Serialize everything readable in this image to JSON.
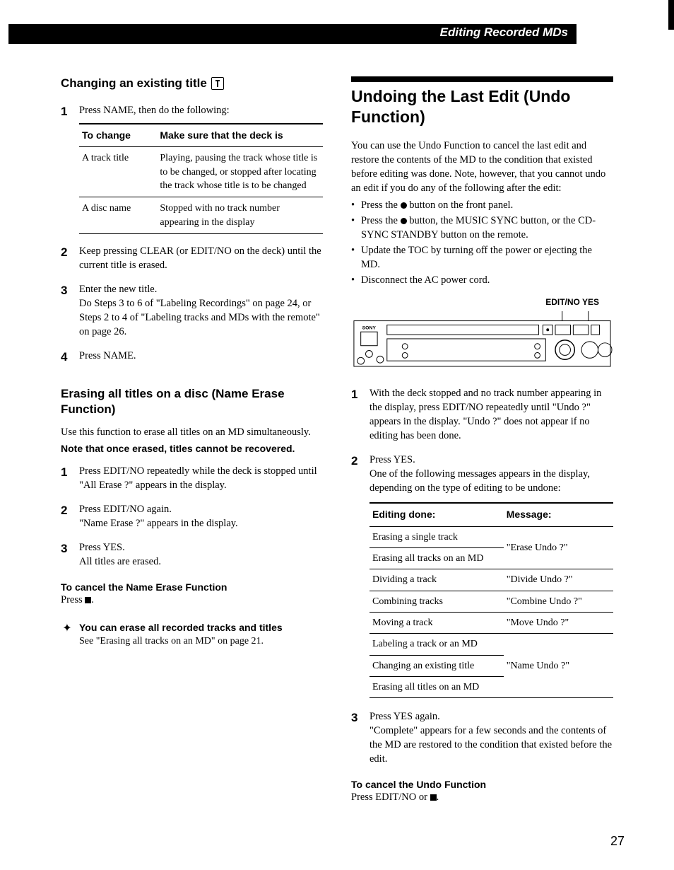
{
  "header": {
    "section": "Editing Recorded MDs"
  },
  "left": {
    "changing": {
      "title": "Changing an existing title",
      "step1": "Press NAME, then do the following:",
      "table": {
        "h1": "To change",
        "h2": "Make sure that the deck is",
        "r1c1": "A track title",
        "r1c2": "Playing, pausing the track whose title is to be changed, or stopped after locating the track whose title is to be changed",
        "r2c1": "A disc name",
        "r2c2": "Stopped with no track number appearing in the display"
      },
      "step2": "Keep pressing CLEAR (or EDIT/NO on the deck) until the current title is erased.",
      "step3a": "Enter the new title.",
      "step3b": "Do Steps 3 to 6 of \"Labeling Recordings\" on page 24, or Steps 2 to 4 of \"Labeling tracks and MDs with the remote\" on page 26.",
      "step4": "Press NAME."
    },
    "erase": {
      "title": "Erasing all titles on a disc (Name Erase Function)",
      "intro": "Use this function to erase all titles on an MD simultaneously.",
      "note": "Note that once erased, titles cannot be recovered.",
      "step1": "Press EDIT/NO repeatedly while the deck is stopped until \"All Erase ?\" appears in the display.",
      "step2a": "Press EDIT/NO again.",
      "step2b": "\"Name Erase ?\" appears in the display.",
      "step3a": "Press YES.",
      "step3b": "All titles are erased.",
      "cancel_h": "To cancel the Name Erase Function",
      "cancel_b": "Press ",
      "tip_h": "You can erase all recorded tracks and titles",
      "tip_b": "See \"Erasing all tracks on an MD\" on page 21."
    }
  },
  "right": {
    "undo": {
      "title": "Undoing the Last Edit (Undo Function)",
      "intro": "You can use the Undo Function to cancel the last edit and restore the contents of the MD to the condition that existed before editing was done. Note, however, that you cannot undo an edit if you do any of the following after the edit:",
      "b1a": "Press the ",
      "b1b": " button on the front panel.",
      "b2a": "Press the ",
      "b2b": " button, the MUSIC SYNC button, or the CD-SYNC STANDBY button on the remote.",
      "b3": "Update the TOC by turning off the power or ejecting the MD.",
      "b4": "Disconnect the AC power cord.",
      "fig_label": "EDIT/NO   YES",
      "step1": "With the deck stopped and no track number appearing in the display, press EDIT/NO repeatedly until \"Undo ?\" appears in the display. \"Undo ?\" does not appear if no editing has been done.",
      "step2a": "Press YES.",
      "step2b": "One of the following messages appears in the display, depending on the type of editing to be undone:",
      "table": {
        "h1": "Editing done:",
        "h2": "Message:",
        "r1": "Erasing a single track",
        "r2": "Erasing all tracks on an MD",
        "m1": "\"Erase Undo ?\"",
        "r3": "Dividing a track",
        "m3": "\"Divide Undo ?\"",
        "r4": "Combining tracks",
        "m4": "\"Combine Undo ?\"",
        "r5": "Moving a track",
        "m5": "\"Move Undo ?\"",
        "r6": "Labeling a track or an MD",
        "r7": "Changing an existing title",
        "r8": "Erasing all titles on an MD",
        "m6": "\"Name Undo ?\""
      },
      "step3a": "Press YES again.",
      "step3b": "\"Complete\" appears for a few seconds and the contents of the MD are restored to the condition that existed before the edit.",
      "cancel_h": "To cancel the Undo Function",
      "cancel_b": "Press EDIT/NO or "
    }
  },
  "page_number": "27"
}
